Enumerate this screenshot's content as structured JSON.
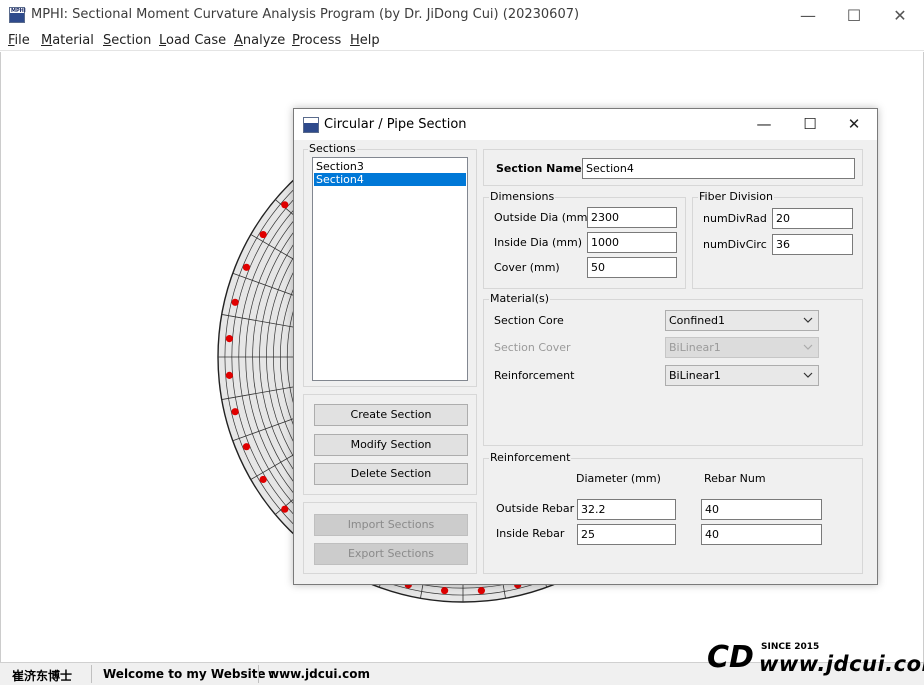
{
  "app": {
    "title": "MPHI: Sectional Moment Curvature Analysis Program (by Dr. JiDong Cui) (20230607)",
    "icon_text": "MPHI"
  },
  "window_controls": {
    "minimize": "—",
    "maximize": "☐",
    "close": "✕"
  },
  "menu": [
    {
      "accel": "F",
      "rest": "ile"
    },
    {
      "accel": "M",
      "rest": "aterial"
    },
    {
      "accel": "S",
      "rest": "ection"
    },
    {
      "accel": "L",
      "rest": "oad Case"
    },
    {
      "accel": "A",
      "rest": "nalyze"
    },
    {
      "accel": "P",
      "rest": "rocess"
    },
    {
      "accel": "H",
      "rest": "elp"
    }
  ],
  "dialog": {
    "title": "Circular / Pipe Section",
    "sections_group": "Sections",
    "sections_list": [
      "Section3",
      "Section4"
    ],
    "selected_section": "Section4",
    "buttons": {
      "create": "Create Section",
      "modify": "Modify Section",
      "delete": "Delete Section",
      "import": "Import Sections",
      "export": "Export Sections"
    },
    "section_name": {
      "label": "Section Name",
      "value": "Section4"
    },
    "dimensions": {
      "group": "Dimensions",
      "outside_dia": {
        "label": "Outside Dia (mm)",
        "value": "2300"
      },
      "inside_dia": {
        "label": "Inside Dia (mm)",
        "value": "1000"
      },
      "cover": {
        "label": "Cover (mm)",
        "value": "50"
      }
    },
    "fiber": {
      "group": "Fiber Division",
      "num_div_rad": {
        "label": "numDivRad",
        "value": "20"
      },
      "num_div_circ": {
        "label": "numDivCirc",
        "value": "36"
      }
    },
    "materials": {
      "group": "Material(s)",
      "core": {
        "label": "Section Core",
        "value": "Confined1"
      },
      "cover": {
        "label": "Section Cover",
        "value": "BiLinear1"
      },
      "reinforcement": {
        "label": "Reinforcement",
        "value": "BiLinear1"
      }
    },
    "reinforcement": {
      "group": "Reinforcement",
      "col_diameter": "Diameter (mm)",
      "col_rebar_num": "Rebar Num",
      "outside": {
        "label": "Outside Rebar",
        "diameter": "32.2",
        "num": "40"
      },
      "inside": {
        "label": "Inside Rebar",
        "diameter": "25",
        "num": "40"
      }
    }
  },
  "status": {
    "author": "崔济东博士",
    "welcome": "Welcome to my Website :",
    "website": "www.jdcui.com"
  },
  "logo": {
    "mark": "CD",
    "since": "SINCE 2015",
    "url": "www.jdcui.com"
  },
  "colors": {
    "rebar": "#e00000",
    "selection": "#0078d7",
    "section_fill": "#e6e6e6"
  }
}
